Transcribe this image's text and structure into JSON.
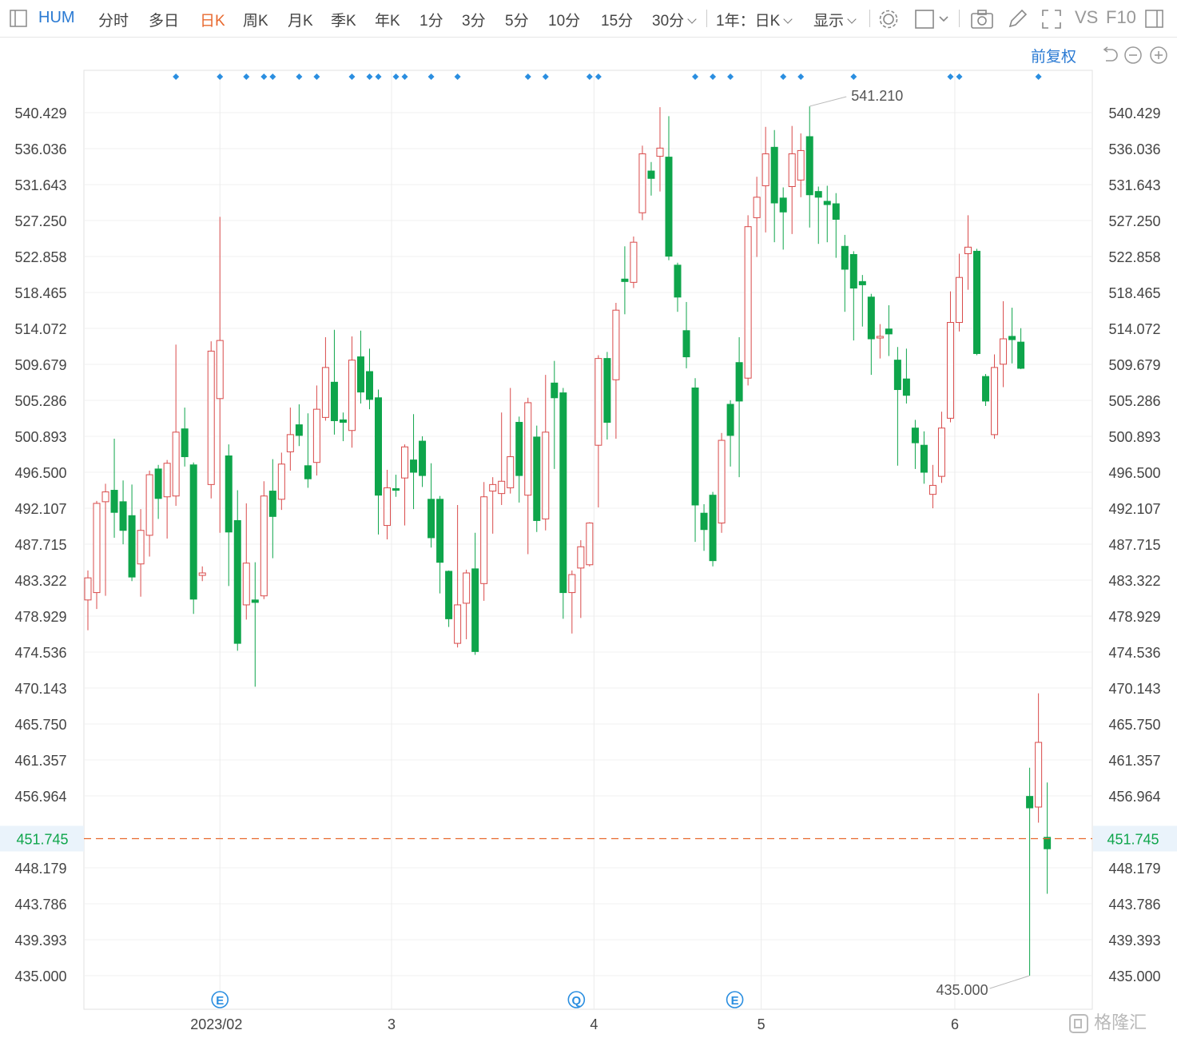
{
  "toolbar": {
    "symbol": "HUM",
    "tabs": [
      "分时",
      "多日",
      "日K",
      "周K",
      "月K",
      "季K",
      "年K",
      "1分",
      "3分",
      "5分",
      "10分",
      "15分",
      "30分"
    ],
    "active_tab": "日K",
    "range_select": "1年：日K",
    "display_select": "显示",
    "vs_label": "VS",
    "f10_label": "F10"
  },
  "chart_controls": {
    "adjust_label": "前复权"
  },
  "watermark": "格隆汇",
  "colors": {
    "up": "#d94a4a",
    "down": "#0ea54b",
    "current_price": "#0ea54b",
    "current_line": "#e8692e",
    "marker": "#2a8ee0",
    "symbol": "#2a7ad3",
    "active_tab": "#e8692e"
  },
  "chart_data": {
    "type": "candlestick",
    "title": "",
    "y_axis_ticks": [
      "540.429",
      "536.036",
      "531.643",
      "527.250",
      "522.858",
      "518.465",
      "514.072",
      "509.679",
      "505.286",
      "500.893",
      "496.500",
      "492.107",
      "487.715",
      "483.322",
      "478.929",
      "474.536",
      "470.143",
      "465.750",
      "461.357",
      "456.964",
      "448.179",
      "443.786",
      "439.393",
      "435.000"
    ],
    "ylim": [
      435.0,
      540.429
    ],
    "x_axis_labels": [
      {
        "index": 14.6,
        "label": "2023/02"
      },
      {
        "index": 34.5,
        "label": "3"
      },
      {
        "index": 57.5,
        "label": "4"
      },
      {
        "index": 76.5,
        "label": "5"
      },
      {
        "index": 98.5,
        "label": "6"
      }
    ],
    "month_dividers": [
      15,
      34.5,
      57.5,
      76.5,
      98.5
    ],
    "current_price": "451.745",
    "high_annotation": {
      "value": "541.210",
      "index": 82
    },
    "low_annotation": {
      "value": "435.000",
      "index": 107
    },
    "event_markers": [
      {
        "index": 15,
        "symbol": "E"
      },
      {
        "index": 55.5,
        "symbol": "Q"
      },
      {
        "index": 73.5,
        "symbol": "E"
      }
    ],
    "top_marker_indices": [
      10,
      15,
      18,
      20,
      21,
      24,
      26,
      30,
      32,
      33,
      35,
      36,
      39,
      42,
      50,
      52,
      57,
      58,
      69,
      71,
      73,
      79,
      81,
      87,
      98,
      99,
      108
    ],
    "candles": [
      [
        480.9,
        483.6,
        477.2,
        484.5
      ],
      [
        481.8,
        492.7,
        479.8,
        493.0
      ],
      [
        492.9,
        494.1,
        481.4,
        495.1
      ],
      [
        494.3,
        491.6,
        488.5,
        500.6
      ],
      [
        492.9,
        489.4,
        487.7,
        495.5
      ],
      [
        491.2,
        483.7,
        483.2,
        495.0
      ],
      [
        485.3,
        489.4,
        481.3,
        492.0
      ],
      [
        488.8,
        496.2,
        486.2,
        496.7
      ],
      [
        496.9,
        493.3,
        490.8,
        497.4
      ],
      [
        493.5,
        497.6,
        488.4,
        498.0
      ],
      [
        493.6,
        501.4,
        492.4,
        512.1
      ],
      [
        501.8,
        498.4,
        497.2,
        504.4
      ],
      [
        497.4,
        481.0,
        479.2,
        497.7
      ],
      [
        483.9,
        484.2,
        483.2,
        485.0
      ],
      [
        495.0,
        511.3,
        493.3,
        512.5
      ],
      [
        505.5,
        512.6,
        489.1,
        527.7
      ],
      [
        498.5,
        489.2,
        482.6,
        499.9
      ],
      [
        490.6,
        475.6,
        474.7,
        494.3
      ],
      [
        480.3,
        485.4,
        478.5,
        492.7
      ],
      [
        480.9,
        480.6,
        470.3,
        485.5
      ],
      [
        481.4,
        493.6,
        481.0,
        495.4
      ],
      [
        494.2,
        491.1,
        486.0,
        498.1
      ],
      [
        493.2,
        497.5,
        491.9,
        498.9
      ],
      [
        499.0,
        501.1,
        496.7,
        504.4
      ],
      [
        502.3,
        501.0,
        499.7,
        504.8
      ],
      [
        497.3,
        495.7,
        494.6,
        503.7
      ],
      [
        497.7,
        504.2,
        496.1,
        507.1
      ],
      [
        503.2,
        509.3,
        502.8,
        513.0
      ],
      [
        507.5,
        502.8,
        501.1,
        513.9
      ],
      [
        502.9,
        502.6,
        500.3,
        503.8
      ],
      [
        501.6,
        510.2,
        499.5,
        513.1
      ],
      [
        510.6,
        506.3,
        504.9,
        513.8
      ],
      [
        508.8,
        505.4,
        504.2,
        511.6
      ],
      [
        505.6,
        493.7,
        488.9,
        506.6
      ],
      [
        490.0,
        494.6,
        488.3,
        496.8
      ],
      [
        494.5,
        494.3,
        493.5,
        496.2
      ],
      [
        495.8,
        499.6,
        490.0,
        499.9
      ],
      [
        498.0,
        496.5,
        492.0,
        503.6
      ],
      [
        500.3,
        496.1,
        494.7,
        500.9
      ],
      [
        493.2,
        488.5,
        487.3,
        497.6
      ],
      [
        493.2,
        485.5,
        481.7,
        493.6
      ],
      [
        484.4,
        478.6,
        477.6,
        484.5
      ],
      [
        475.6,
        480.3,
        475.1,
        492.5
      ],
      [
        480.5,
        484.2,
        476.1,
        484.6
      ],
      [
        484.7,
        474.6,
        474.2,
        489.1
      ],
      [
        482.9,
        493.5,
        480.8,
        495.3
      ],
      [
        494.2,
        495.0,
        489.0,
        495.9
      ],
      [
        493.9,
        495.4,
        492.5,
        503.8
      ],
      [
        494.6,
        498.4,
        493.9,
        506.8
      ],
      [
        502.6,
        496.1,
        492.8,
        503.3
      ],
      [
        493.7,
        505.0,
        486.5,
        505.6
      ],
      [
        500.8,
        490.6,
        489.2,
        502.2
      ],
      [
        490.8,
        501.4,
        489.4,
        508.4
      ],
      [
        507.4,
        505.6,
        496.9,
        510.1
      ],
      [
        506.2,
        481.8,
        478.6,
        506.8
      ],
      [
        481.8,
        484.0,
        476.8,
        484.5
      ],
      [
        484.8,
        487.4,
        478.7,
        488.2
      ],
      [
        485.2,
        490.3,
        485.0,
        490.4
      ],
      [
        499.8,
        510.4,
        492.2,
        510.8
      ],
      [
        510.4,
        502.6,
        500.5,
        511.2
      ],
      [
        507.8,
        516.3,
        500.6,
        517.2
      ],
      [
        520.1,
        519.8,
        515.8,
        524.1
      ],
      [
        519.7,
        524.6,
        519.0,
        525.3
      ],
      [
        528.2,
        535.4,
        527.3,
        536.4
      ],
      [
        533.3,
        532.4,
        530.3,
        534.4
      ],
      [
        535.1,
        536.1,
        530.8,
        541.1
      ],
      [
        535.0,
        522.9,
        522.4,
        540.0
      ],
      [
        521.8,
        517.9,
        516.1,
        522.1
      ],
      [
        513.8,
        510.6,
        509.2,
        517.3
      ],
      [
        506.8,
        492.5,
        488.0,
        508.0
      ],
      [
        491.5,
        489.5,
        486.9,
        492.6
      ],
      [
        493.7,
        485.7,
        485.0,
        494.1
      ],
      [
        490.3,
        500.4,
        489.1,
        501.3
      ],
      [
        504.8,
        501.0,
        497.2,
        505.3
      ],
      [
        509.9,
        505.2,
        495.9,
        513.0
      ],
      [
        508.0,
        526.5,
        507.1,
        527.9
      ],
      [
        527.6,
        530.1,
        522.8,
        532.6
      ],
      [
        531.5,
        535.4,
        525.8,
        538.7
      ],
      [
        536.2,
        529.4,
        524.6,
        538.3
      ],
      [
        530.0,
        528.3,
        523.7,
        531.3
      ],
      [
        531.4,
        535.4,
        525.6,
        538.8
      ],
      [
        532.2,
        535.8,
        530.1,
        537.9
      ],
      [
        537.5,
        530.4,
        526.4,
        541.2
      ],
      [
        530.8,
        530.1,
        524.4,
        531.4
      ],
      [
        529.6,
        529.2,
        524.6,
        531.5
      ],
      [
        529.3,
        527.4,
        522.7,
        530.6
      ],
      [
        524.1,
        521.3,
        516.1,
        525.5
      ],
      [
        523.1,
        519.0,
        512.6,
        523.5
      ],
      [
        519.8,
        519.4,
        514.3,
        520.6
      ],
      [
        517.9,
        512.8,
        508.4,
        518.3
      ],
      [
        512.9,
        513.1,
        510.4,
        514.6
      ],
      [
        514.0,
        513.4,
        510.7,
        516.9
      ],
      [
        510.2,
        506.6,
        497.3,
        511.8
      ],
      [
        507.9,
        505.9,
        504.9,
        511.6
      ],
      [
        501.9,
        500.1,
        496.9,
        502.9
      ],
      [
        499.8,
        496.5,
        495.1,
        501.5
      ],
      [
        493.8,
        494.9,
        492.1,
        497.4
      ],
      [
        496.0,
        501.9,
        495.2,
        503.9
      ],
      [
        503.1,
        514.8,
        502.6,
        518.6
      ],
      [
        514.8,
        520.3,
        513.7,
        523.2
      ],
      [
        523.2,
        524.0,
        518.8,
        527.9
      ],
      [
        523.5,
        511.0,
        510.8,
        523.8
      ],
      [
        508.2,
        505.2,
        504.6,
        508.5
      ],
      [
        501.1,
        509.3,
        500.6,
        510.9
      ],
      [
        509.7,
        512.8,
        506.9,
        517.4
      ],
      [
        513.1,
        512.7,
        509.8,
        516.6
      ],
      [
        512.4,
        509.2,
        509.1,
        514.1
      ],
      [
        456.9,
        455.5,
        435.0,
        460.4
      ],
      [
        455.6,
        463.5,
        453.7,
        469.5
      ],
      [
        451.9,
        450.5,
        445.0,
        458.6
      ]
    ]
  }
}
